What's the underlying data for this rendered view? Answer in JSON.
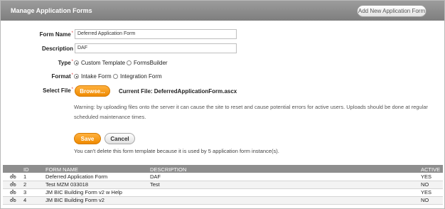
{
  "header": {
    "title": "Manage Application Forms",
    "add_button": "Add New Application Form"
  },
  "form": {
    "form_name_label": "Form Name",
    "form_name_value": "Deferred Application Form",
    "description_label": "Description",
    "description_value": "DAF",
    "type_label": "Type",
    "type_options": [
      "Custom Template",
      "FormsBuilder"
    ],
    "type_selected": "Custom Template",
    "format_label": "Format",
    "format_options": [
      "Intake Form",
      "Integration Form"
    ],
    "format_selected": "Intake Form",
    "select_file_label": "Select File",
    "browse_label": "Browse...",
    "current_file": "Current File: DeferredApplicationForm.ascx",
    "warning": "Warning: by uploading files onto the server it can cause the site to reset and cause potential errors for active users. Uploads should be done at regular scheduled maintenance times.",
    "save_label": "Save",
    "cancel_label": "Cancel",
    "delete_note": "You can't delete this form template because it is used by 5 application form instance(s)."
  },
  "table": {
    "columns": [
      "",
      "ID",
      "FORM NAME",
      "DESCRIPTION",
      "ACTIVE"
    ],
    "rows": [
      {
        "icon": "edit-icon",
        "id": "1",
        "name": "Deferred Application Form",
        "description": "DAF",
        "active": "YES"
      },
      {
        "icon": "edit-icon",
        "id": "2",
        "name": "Test MZM 033018",
        "description": "Test",
        "active": "NO"
      },
      {
        "icon": "edit-icon",
        "id": "3",
        "name": "JM BIC Building Form v2 w Help",
        "description": "",
        "active": "YES"
      },
      {
        "icon": "edit-icon",
        "id": "4",
        "name": "JM BIC Building Form v2",
        "description": "",
        "active": "NO"
      }
    ]
  },
  "colors": {
    "header_bg": "#8e8e8e",
    "accent_orange": "#ef8a00",
    "required_star": "#dd3333"
  }
}
